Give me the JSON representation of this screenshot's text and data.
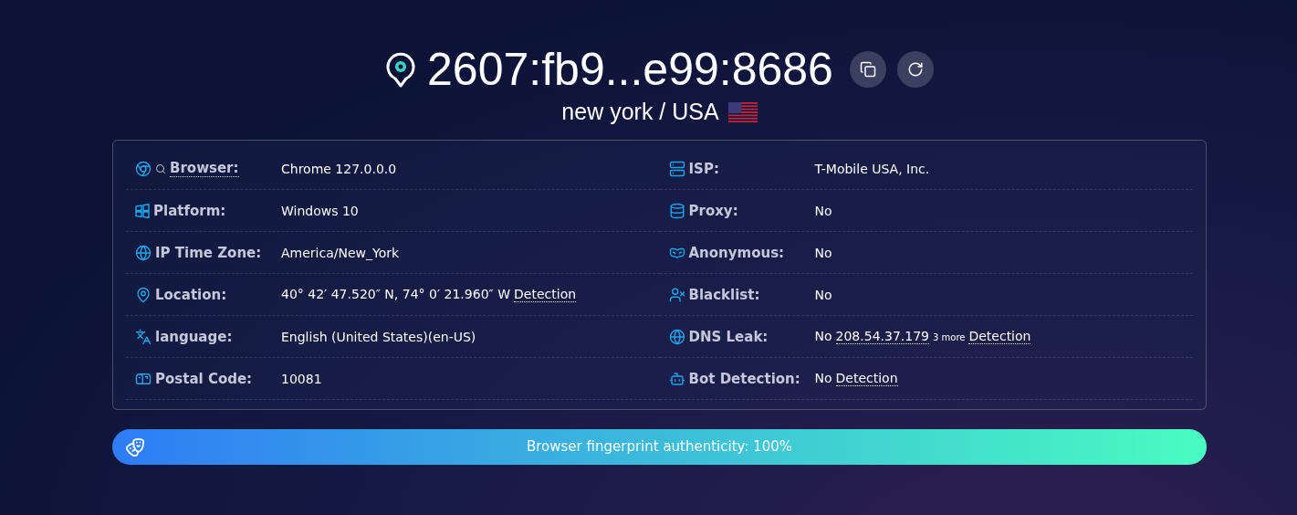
{
  "header": {
    "ip": "2607:fb9...e99:8686",
    "location": "new york / USA"
  },
  "info": {
    "left": [
      {
        "label": "Browser:",
        "label_link": true,
        "value": [
          {
            "kind": "plain",
            "text": "Chrome 127.0.0.0"
          }
        ]
      },
      {
        "label": "Platform:",
        "label_link": false,
        "value": [
          {
            "kind": "plain",
            "text": "Windows 10"
          }
        ]
      },
      {
        "label": "IP Time Zone:",
        "label_link": false,
        "value": [
          {
            "kind": "plain",
            "text": "America/New_York"
          }
        ]
      },
      {
        "label": "Location:",
        "label_link": false,
        "value": [
          {
            "kind": "plain",
            "text": "40° 42′ 47.520″ N, 74° 0′ 21.960″ W"
          },
          {
            "kind": "link",
            "text": "Detection"
          }
        ]
      },
      {
        "label": "language:",
        "label_link": false,
        "value": [
          {
            "kind": "plain",
            "text": "English (United States)(en-US)"
          }
        ]
      },
      {
        "label": "Postal Code:",
        "label_link": false,
        "value": [
          {
            "kind": "plain",
            "text": "10081"
          }
        ]
      }
    ],
    "right": [
      {
        "label": "ISP:",
        "label_link": false,
        "value": [
          {
            "kind": "plain",
            "text": "T-Mobile USA, Inc."
          }
        ]
      },
      {
        "label": "Proxy:",
        "label_link": false,
        "value": [
          {
            "kind": "plain",
            "text": "No"
          }
        ]
      },
      {
        "label": "Anonymous:",
        "label_link": false,
        "value": [
          {
            "kind": "plain",
            "text": "No"
          }
        ]
      },
      {
        "label": "Blacklist:",
        "label_link": false,
        "value": [
          {
            "kind": "plain",
            "text": "No"
          }
        ]
      },
      {
        "label": "DNS Leak:",
        "label_link": false,
        "value": [
          {
            "kind": "plain",
            "text": "No"
          },
          {
            "kind": "link",
            "text": "208.54.37.179"
          },
          {
            "kind": "sup",
            "text": "3 more"
          },
          {
            "kind": "link",
            "text": "Detection"
          }
        ]
      },
      {
        "label": "Bot Detection:",
        "label_link": false,
        "value": [
          {
            "kind": "plain",
            "text": "No"
          },
          {
            "kind": "link",
            "text": "Detection"
          }
        ]
      }
    ]
  },
  "authenticity": {
    "text": "Browser fingerprint authenticity: 100%"
  }
}
